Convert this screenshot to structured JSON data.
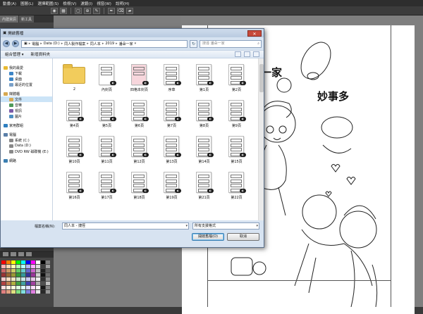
{
  "app": {
    "menu": [
      "動畫(A)",
      "圖層(L)",
      "選擇範圍(S)",
      "檢視(V)",
      "濾鏡(I)",
      "視窗(W)",
      "說明(H)"
    ],
    "panel_tabs": [
      "內建資訊",
      "新工具"
    ],
    "toolbar_icons": [
      "eye-icon",
      "grid-icon",
      "fit-icon",
      "zoom-icon",
      "brush-icon",
      "pen-icon",
      "eraser-icon",
      "fill-icon"
    ]
  },
  "dialog": {
    "title": "開啟舊檔",
    "close_label": "✕",
    "address": [
      "電腦",
      "Data (D:)",
      "同人製作檔案",
      "同人本",
      "2019",
      "潘朵一家"
    ],
    "search_placeholder": "搜尋 潘朵一家",
    "commands": {
      "organize": "組合管理 ▾",
      "new_folder": "新增資料夾"
    },
    "nav": [
      {
        "label": "我的最愛",
        "type": "header",
        "icon": "star-icon"
      },
      {
        "label": "下載",
        "type": "child",
        "icon": "download-icon"
      },
      {
        "label": "桌面",
        "type": "child",
        "icon": "desktop-icon"
      },
      {
        "label": "最近的位置",
        "type": "child",
        "icon": "recent-icon"
      },
      {
        "label": "媒體櫃",
        "type": "header",
        "icon": "library-icon"
      },
      {
        "label": "文件",
        "type": "child",
        "icon": "documents-icon",
        "selected": true
      },
      {
        "label": "音樂",
        "type": "child",
        "icon": "music-icon"
      },
      {
        "label": "視訊",
        "type": "child",
        "icon": "video-icon"
      },
      {
        "label": "圖片",
        "type": "child",
        "icon": "pictures-icon"
      },
      {
        "label": "家用群組",
        "type": "header",
        "icon": "homegroup-icon"
      },
      {
        "label": "電腦",
        "type": "header",
        "icon": "computer-icon"
      },
      {
        "label": "系統 (C:)",
        "type": "child",
        "icon": "drive-icon"
      },
      {
        "label": "Data (D:)",
        "type": "child",
        "icon": "drive-icon"
      },
      {
        "label": "DVD RW 磁碟機 (E:)",
        "type": "child",
        "icon": "dvd-icon"
      },
      {
        "label": "網路",
        "type": "header",
        "icon": "network-icon"
      }
    ],
    "files": [
      "2",
      "內封頁",
      "四格本封頁",
      "序章",
      "第1頁",
      "第2頁",
      "第4頁",
      "第5頁",
      "第6頁",
      "第7頁",
      "第8頁",
      "第9頁",
      "第10頁",
      "第11頁",
      "第12頁",
      "第13頁",
      "第14頁",
      "第15頁",
      "第16頁",
      "第17頁",
      "第18頁",
      "第19頁",
      "第21頁",
      "第22頁"
    ],
    "filename_label": "檔案名稱(N):",
    "filename_value": "同人本 - 捷徑",
    "filter_value": "所有支援格式",
    "open_button": "開啟舊檔(O)",
    "cancel_button": "取消"
  },
  "canvas": {
    "title_line1": "一家",
    "title_line2": "妙事多"
  },
  "colors": {
    "accent": "#3c7fb1",
    "close": "#c74a3a",
    "folder": "#f2cc5c"
  }
}
